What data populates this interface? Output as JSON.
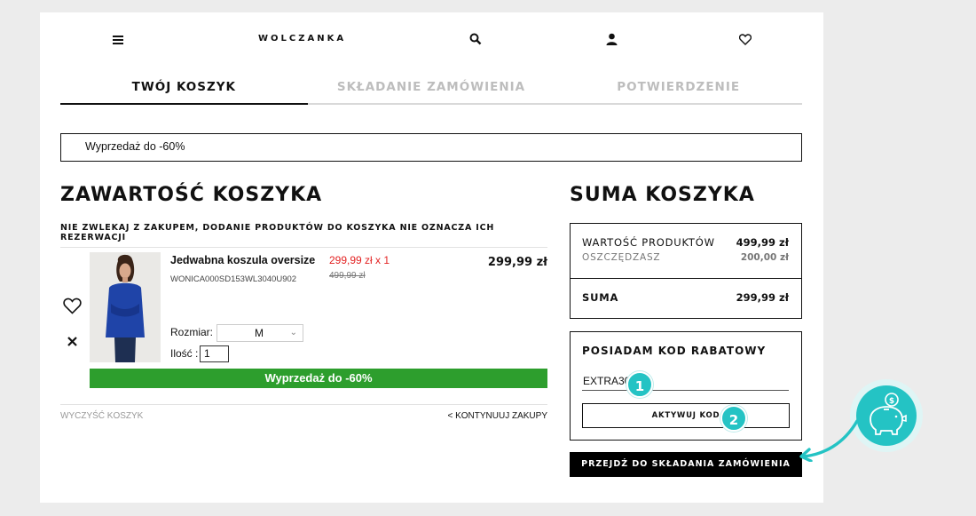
{
  "header": {
    "logo": "WOLCZANKA",
    "icons": [
      "menu-icon",
      "search-icon",
      "user-icon",
      "heart-icon"
    ]
  },
  "steps": [
    {
      "label": "TWÓJ KOSZYK",
      "active": true
    },
    {
      "label": "SKŁADANIE ZAMÓWIENIA",
      "active": false
    },
    {
      "label": "POTWIERDZENIE",
      "active": false
    }
  ],
  "promo_banner": "Wyprzedaż do -60%",
  "cart": {
    "title": "ZAWARTOŚĆ KOSZYKA",
    "notice": "NIE ZWLEKAJ Z ZAKUPEM, DODANIE PRODUKTÓW DO KOSZYKA NIE OZNACZA ICH REZERWACJI",
    "item": {
      "name": "Jedwabna koszula oversize",
      "sku": "WONICA000SD153WL3040U902",
      "unit_price": "299,99 zł x 1",
      "old_price": "499,99 zł",
      "total": "299,99 zł",
      "size_label": "Rozmiar:",
      "size_value": "M",
      "qty_label": "Ilość :",
      "qty_value": "1",
      "sale_label": "Wyprzedaż do -60%"
    },
    "clear_link": "WYCZYŚĆ KOSZYK",
    "continue_link": "< KONTYNUUJ ZAKUPY"
  },
  "summary": {
    "title": "SUMA KOSZYKA",
    "products_label": "WARTOŚĆ PRODUKTÓW",
    "products_value": "499,99 zł",
    "savings_label": "OSZCZĘDZASZ",
    "savings_value": "200,00 zł",
    "total_label": "SUMA",
    "total_value": "299,99 zł"
  },
  "discount": {
    "title": "POSIADAM KOD RABATOWY",
    "code_value": "EXTRA30",
    "activate_label": "AKTYWUJ KOD"
  },
  "checkout_label": "PRZEJDŹ DO SKŁADANIA ZAMÓWIENIA",
  "annotations": {
    "badge1": "1",
    "badge2": "2"
  },
  "colors": {
    "sale_green": "#2d9e2d",
    "price_red": "#e32222",
    "accent_teal": "#24c3c4"
  }
}
